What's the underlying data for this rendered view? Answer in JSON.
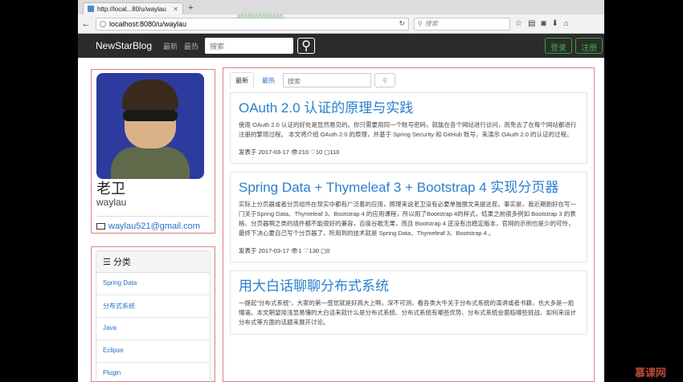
{
  "browser": {
    "tab_title": "http://local...80/u/waylau",
    "new_tab": "+",
    "url": "localhost:8080/u/waylau",
    "url_ghost": "#666666666666",
    "search_placeholder": "搜索"
  },
  "site": {
    "brand": "NewStarBlog",
    "nav_latest": "最新",
    "nav_hot": "最热",
    "search_placeholder": "搜索",
    "login": "登录",
    "register": "注册"
  },
  "profile": {
    "name": "老卫",
    "username": "waylau",
    "email": "waylau521@gmail.com"
  },
  "categories": {
    "title": "分类",
    "items": [
      "Spring Data",
      "分布式系统",
      "Java",
      "Eclipse",
      "Plugin"
    ]
  },
  "main": {
    "tab_latest": "最新",
    "tab_hot": "最热",
    "search_placeholder": "搜索",
    "posts": [
      {
        "title": "OAuth 2.0 认证的原理与实践",
        "summary": "使用 OAuth 2.0 认证的好处是显然易见的。你只需要用同一个账号密码，就能在各个网站进行访问，而免去了在每个网站都进行注册的繁琐过程。 本文将介绍 OAuth 2.0 的原理，并基于 Spring Security 和 GitHub 账号，来演示 OAuth 2.0 的认证的过程。",
        "meta": "发表于 2017-03-17 👁210 ♡10 ▢110"
      },
      {
        "title": "Spring Data + Thymeleaf 3 + Bootstrap 4 实现分页器",
        "summary": "实际上分页器或者分页组件在现实中都有广泛着的应用，照理来说老卫没有必要单独撰文来提这茬。事实是，我近期刚好在写一门关于Spring Data、Thymeleaf 3、Bootstrap 4 的应用课程，所以用了Bootstrap 4的样式，结果之前很多例如 Bootstrap 3 的表格、分页器啊之类的插件都不能很好的兼容，百度谷歌无果，而且 Bootstrap 4 还没有出稳定版本，官网的示例也是少的可怜，最终下决心要自己写个分页器了，所用到的技术就是 Spring Data、Thymeleaf 3、Bootstrap 4 。",
        "meta": "发表于 2017-03-17 👁1 ♡130 ▢0"
      },
      {
        "title": "用大白话聊聊分布式系统",
        "summary": "一提起“分布式系统”，大家的第一感觉就是好高大上啊，深不可测，看各类大牛关于分布式系统的演讲或者书籍，也大多是一脸懵逼。本文期望用浅显易懂的大白话来就什么是分布式系统、分布式系统有哪些优势、分布式系统会面临哪些挑战、如何来设计分布式等方面的话题来展开讨论。",
        "meta": ""
      }
    ]
  },
  "watermark": "慕课网"
}
